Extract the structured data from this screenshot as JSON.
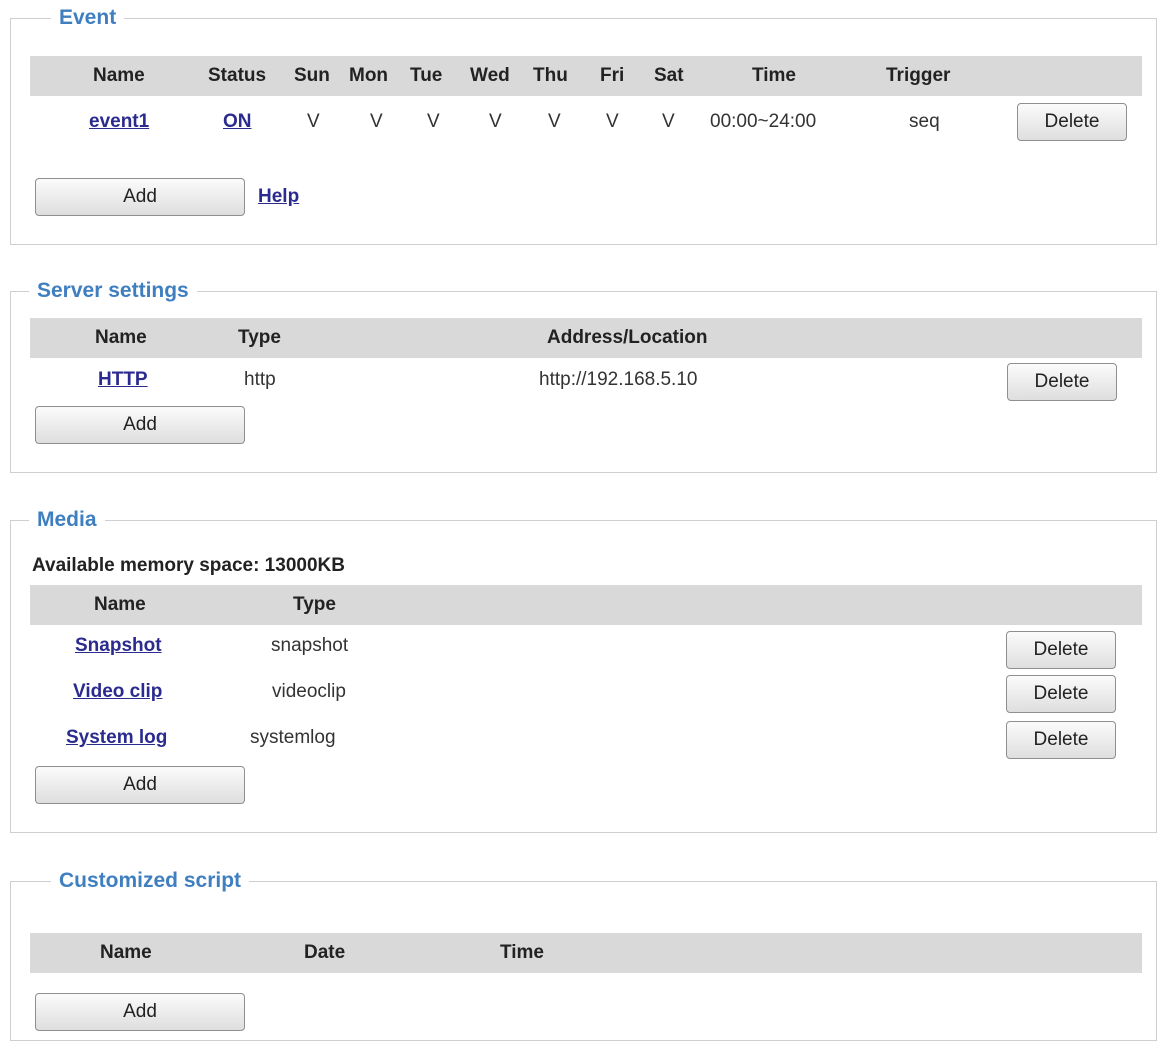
{
  "event": {
    "legend": "Event",
    "headers": {
      "name": "Name",
      "status": "Status",
      "sun": "Sun",
      "mon": "Mon",
      "tue": "Tue",
      "wed": "Wed",
      "thu": "Thu",
      "fri": "Fri",
      "sat": "Sat",
      "time": "Time",
      "trigger": "Trigger"
    },
    "rows": [
      {
        "name": "event1",
        "status": "ON",
        "sun": "V",
        "mon": "V",
        "tue": "V",
        "wed": "V",
        "thu": "V",
        "fri": "V",
        "sat": "V",
        "time": "00:00~24:00",
        "trigger": "seq",
        "delete_label": "Delete"
      }
    ],
    "add_label": "Add",
    "help_label": "Help"
  },
  "server": {
    "legend": "Server settings",
    "headers": {
      "name": "Name",
      "type": "Type",
      "address": "Address/Location"
    },
    "rows": [
      {
        "name": "HTTP",
        "type": "http",
        "address": "http://192.168.5.10",
        "delete_label": "Delete"
      }
    ],
    "add_label": "Add"
  },
  "media": {
    "legend": "Media",
    "memory_text": "Available memory space: 13000KB",
    "headers": {
      "name": "Name",
      "type": "Type"
    },
    "rows": [
      {
        "name": "Snapshot",
        "type": "snapshot",
        "delete_label": "Delete"
      },
      {
        "name": "Video clip",
        "type": "videoclip",
        "delete_label": "Delete"
      },
      {
        "name": "System log",
        "type": "systemlog",
        "delete_label": "Delete"
      }
    ],
    "add_label": "Add"
  },
  "script": {
    "legend": "Customized script",
    "headers": {
      "name": "Name",
      "date": "Date",
      "time": "Time"
    },
    "add_label": "Add"
  },
  "colors": {
    "legend": "#3f7fc0",
    "header_bg": "#d9d9d9",
    "link": "#2b2b8f",
    "border": "#cfcfcf"
  }
}
